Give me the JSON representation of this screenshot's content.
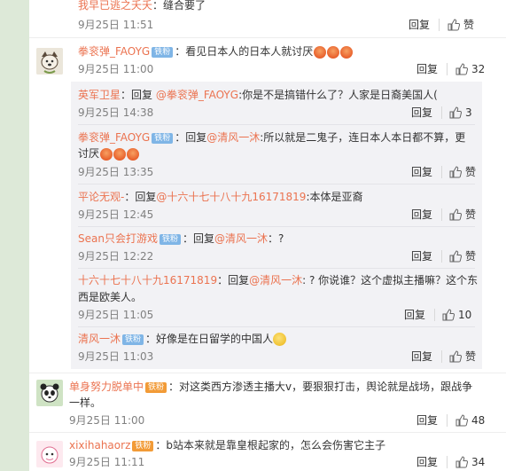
{
  "thread": [
    {
      "user": "我早已逃之夭夭",
      "sep": "：",
      "text": "缝合要了",
      "time": "9月25日 11:51",
      "reply": "回复",
      "like_label": "赞",
      "likes": ""
    },
    {
      "user": "拳衮弹_FAOYG",
      "badge": "铁粉",
      "sep": "：",
      "text": "看见日本人的日本人就讨厌",
      "time": "9月25日 11:00",
      "reply": "回复",
      "likes": "32",
      "subreplies": [
        {
          "user": "英军卫星",
          "sep": "：回复 ",
          "mention": "@拳衮弹_FAOYG",
          "text": ":你是不是搞错什么了？人家是日裔美国人(",
          "time": "9月25日 14:38",
          "reply": "回复",
          "likes": "3"
        },
        {
          "user": "拳衮弹_FAOYG",
          "badge": "铁粉",
          "sep": "：回复",
          "mention": "@清风一沐",
          "text": ":所以就是二鬼子，连日本人本日都不算，更",
          "text2": "讨厌",
          "time": "9月25日 13:35",
          "reply": "回复",
          "like_label": "赞"
        },
        {
          "user": "平论无观-",
          "sep": "：回复",
          "mention": "@十六十七十八十九16171819",
          "text": ":本体是亚裔",
          "time": "9月25日 12:45",
          "reply": "回复",
          "like_label": "赞"
        },
        {
          "user": "Sean只会打游戏",
          "badge": "铁粉",
          "sep": "：回复",
          "mention": "@清风一沐",
          "text": "：?",
          "time": "9月25日 12:22",
          "reply": "回复",
          "like_label": "赞"
        },
        {
          "user": "十六十七十八十九16171819",
          "sep": "：回复",
          "mention": "@清风一沐",
          "text": ": ? 你说谁？这个虚拟主播嘛？这个东",
          "text2": "西是欧美人。",
          "time": "9月25日 11:05",
          "reply": "回复",
          "likes": "10"
        },
        {
          "user": "清风一沐",
          "badge": "铁粉",
          "sep": "：",
          "text": "好像是在日留学的中国人",
          "time": "9月25日 11:03",
          "reply": "回复",
          "like_label": "赞"
        }
      ]
    },
    {
      "user": "单身努力脱单中",
      "badge": "铁粉",
      "sep": "：",
      "text": "对这类西方渗透主播大v，要狠狠打击，舆论就是战场，跟战争",
      "text2": "一样。",
      "time": "9月25日 11:00",
      "reply": "回复",
      "likes": "48"
    },
    {
      "user": "xixihahaorz",
      "badge": "铁粉",
      "sep": "：",
      "text": "b站本来就是靠皇根起家的，怎么会伤害它主子",
      "time": "9月25日 11:11",
      "reply": "回复",
      "likes": "34"
    }
  ],
  "colors": {
    "link": "#eb7350",
    "badge": "#7fb5e6",
    "reply_bg": "#f2f2f5",
    "page_bg": "#dde9d8"
  },
  "icons": {
    "like": "thumb-up-icon",
    "emoji_angry": "angry-face-emoji",
    "emoji_smile": "smile-face-emoji"
  }
}
